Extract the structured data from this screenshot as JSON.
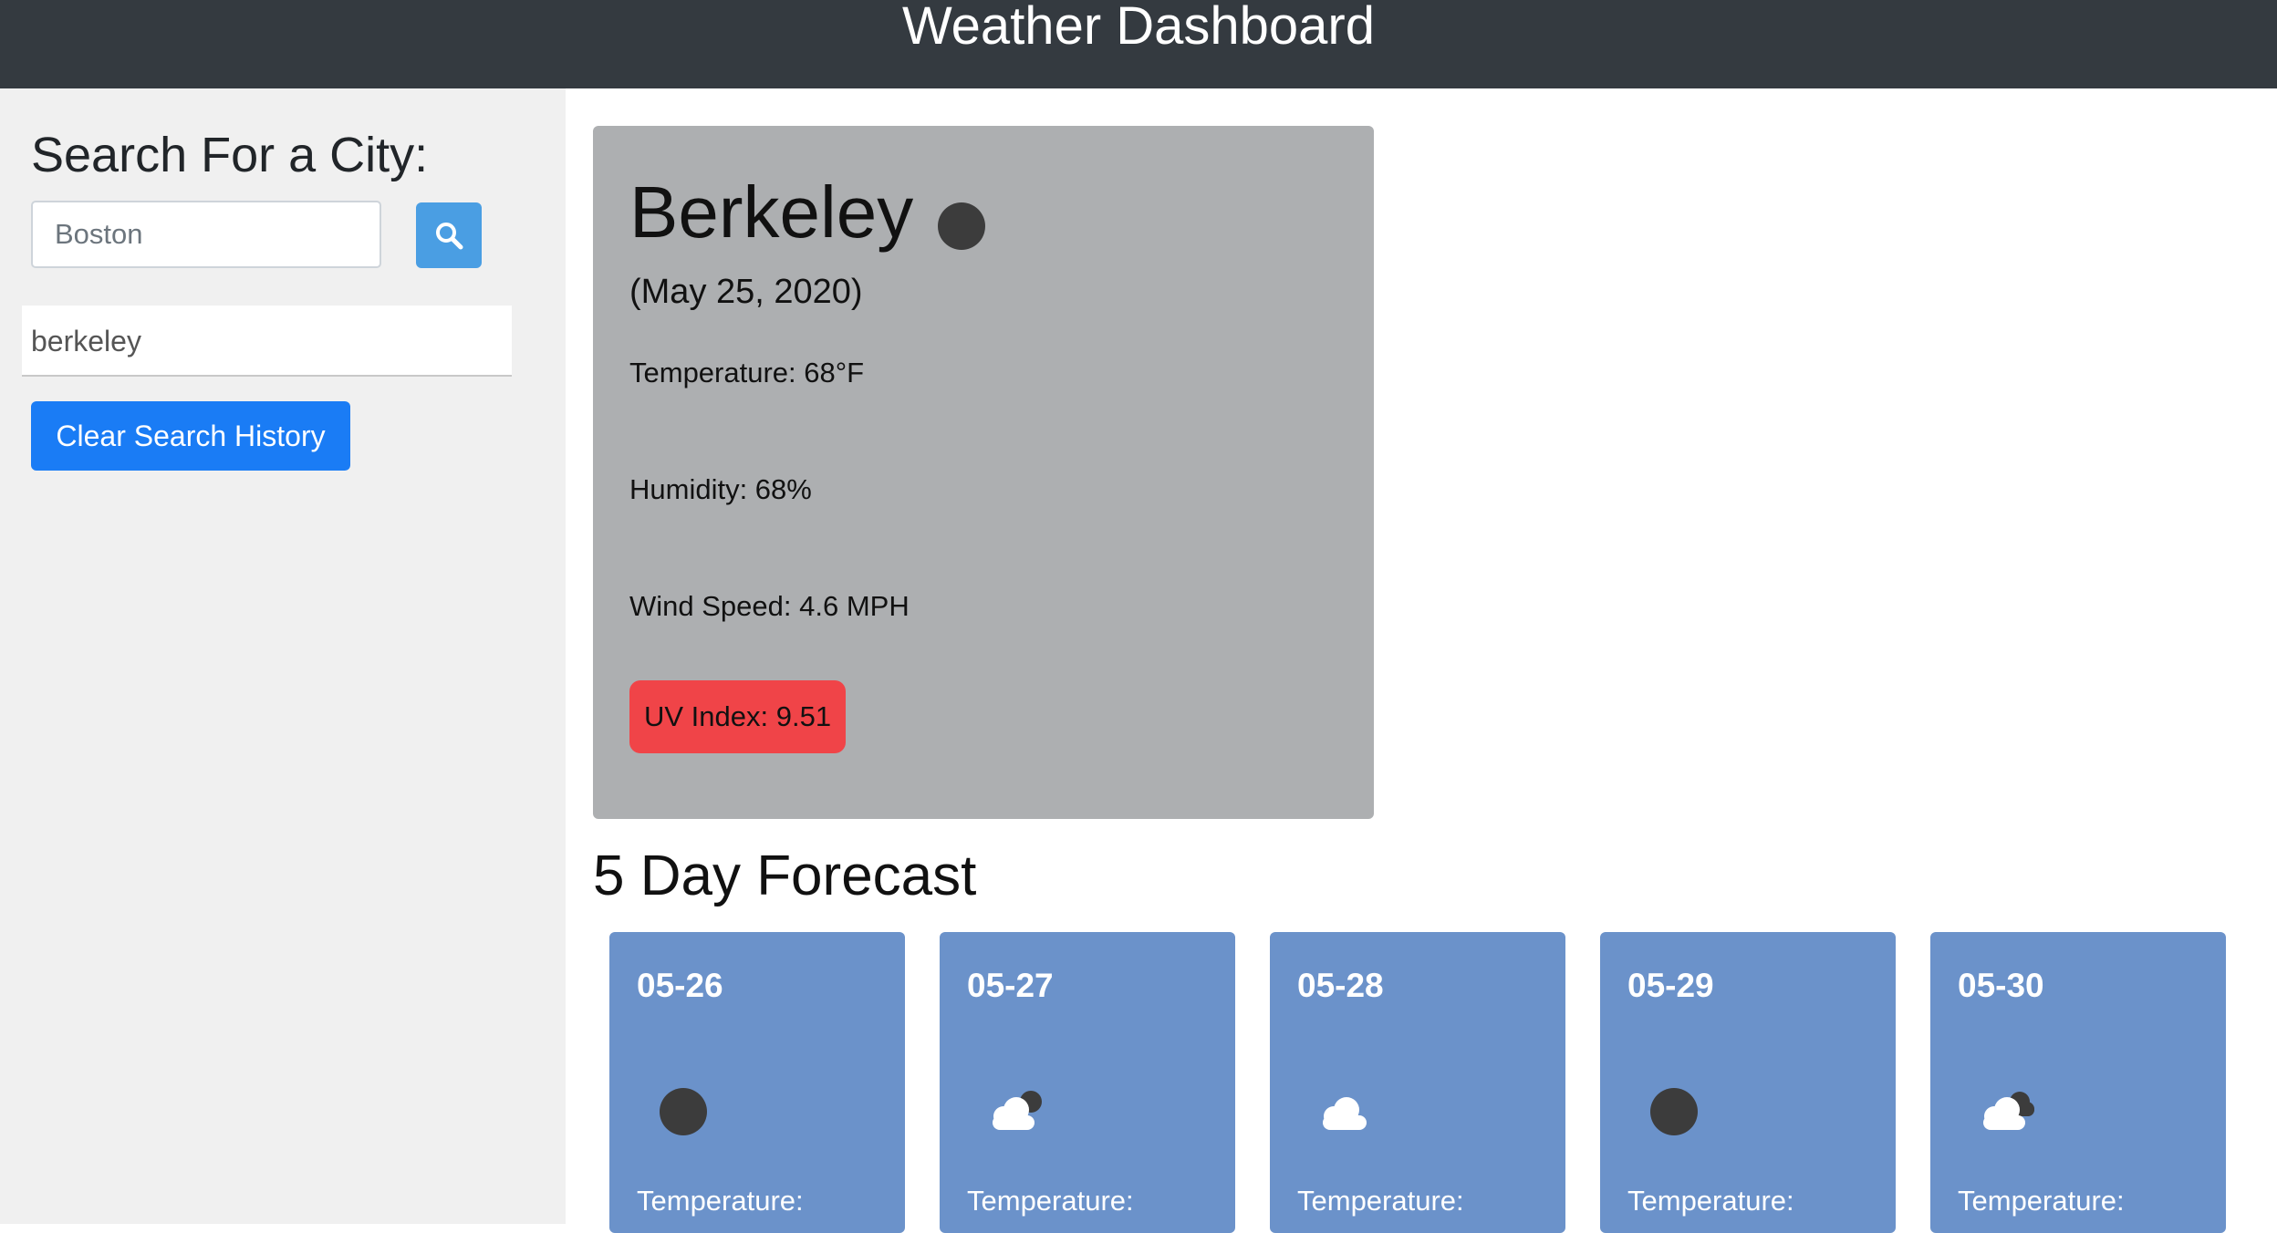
{
  "header": {
    "title": "Weather Dashboard"
  },
  "sidebar": {
    "heading": "Search For a City:",
    "search_value": "Boston",
    "history": [
      "berkeley"
    ],
    "clear_label": "Clear Search History"
  },
  "current": {
    "city": "Berkeley",
    "date": "(May 25, 2020)",
    "temperature": "Temperature: 68°F",
    "humidity": "Humidity: 68%",
    "wind": "Wind Speed: 4.6 MPH",
    "uv": "UV Index: 9.51",
    "uv_color": "#f04448",
    "icon": "clear-night-icon"
  },
  "forecast": {
    "title": "5 Day Forecast",
    "days": [
      {
        "date": "05-26",
        "icon": "clear-night-icon",
        "temp_label": "Temperature:"
      },
      {
        "date": "05-27",
        "icon": "partly-cloudy-icon",
        "temp_label": "Temperature:"
      },
      {
        "date": "05-28",
        "icon": "cloud-icon",
        "temp_label": "Temperature:"
      },
      {
        "date": "05-29",
        "icon": "clear-night-icon",
        "temp_label": "Temperature:"
      },
      {
        "date": "05-30",
        "icon": "broken-clouds-icon",
        "temp_label": "Temperature:"
      }
    ]
  },
  "colors": {
    "header_bg": "#343a40",
    "sidebar_bg": "#f0f0f0",
    "card_bg": "#adafb1",
    "forecast_bg": "#6b92ca",
    "primary": "#1a7cf5"
  }
}
